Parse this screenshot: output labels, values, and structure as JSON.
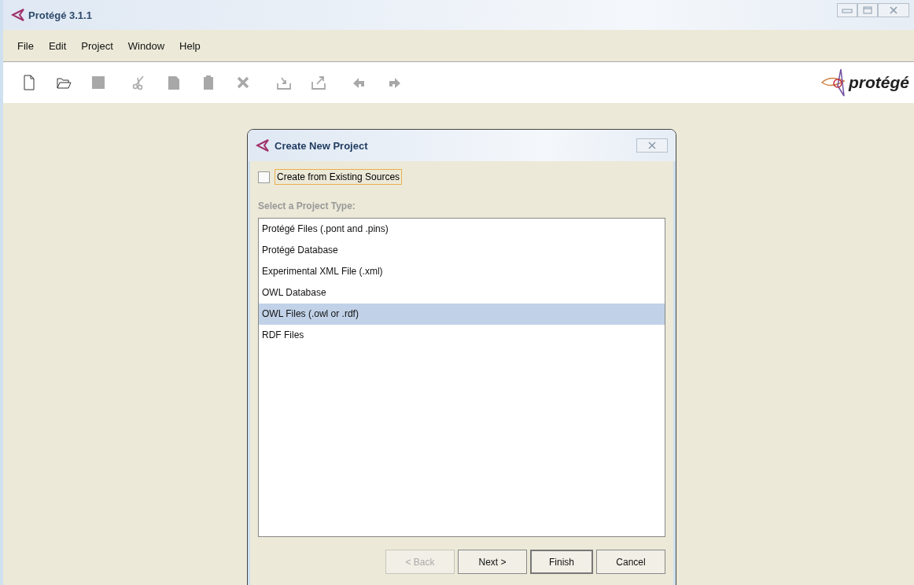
{
  "window": {
    "title": "Protégé 3.1.1"
  },
  "menu": [
    "File",
    "Edit",
    "Project",
    "Window",
    "Help"
  ],
  "toolbar": [
    {
      "kind": "new",
      "disabled": false
    },
    {
      "kind": "open",
      "disabled": false
    },
    {
      "kind": "save",
      "disabled": true
    },
    {
      "kind": "cut",
      "disabled": true
    },
    {
      "kind": "copy",
      "disabled": true
    },
    {
      "kind": "paste",
      "disabled": true
    },
    {
      "kind": "delete",
      "disabled": true
    },
    {
      "kind": "import",
      "disabled": true
    },
    {
      "kind": "export",
      "disabled": true
    },
    {
      "kind": "undo",
      "disabled": true
    },
    {
      "kind": "redo",
      "disabled": true
    }
  ],
  "logo": {
    "text": "protégé"
  },
  "dialog": {
    "title": "Create New Project",
    "checkbox": {
      "label": "Create from Existing Sources",
      "checked": false
    },
    "list_label": "Select a Project Type:",
    "items": [
      {
        "label": "Protégé Files (.pont and .pins)",
        "selected": false
      },
      {
        "label": "Protégé Database",
        "selected": false
      },
      {
        "label": "Experimental XML File (.xml)",
        "selected": false
      },
      {
        "label": "OWL Database",
        "selected": false
      },
      {
        "label": "OWL Files (.owl or .rdf)",
        "selected": true
      },
      {
        "label": "RDF Files",
        "selected": false
      }
    ],
    "buttons": [
      {
        "label": "< Back",
        "disabled": true,
        "default": false
      },
      {
        "label": "Next >",
        "disabled": false,
        "default": false
      },
      {
        "label": "Finish",
        "disabled": false,
        "default": true
      },
      {
        "label": "Cancel",
        "disabled": false,
        "default": false
      }
    ]
  }
}
